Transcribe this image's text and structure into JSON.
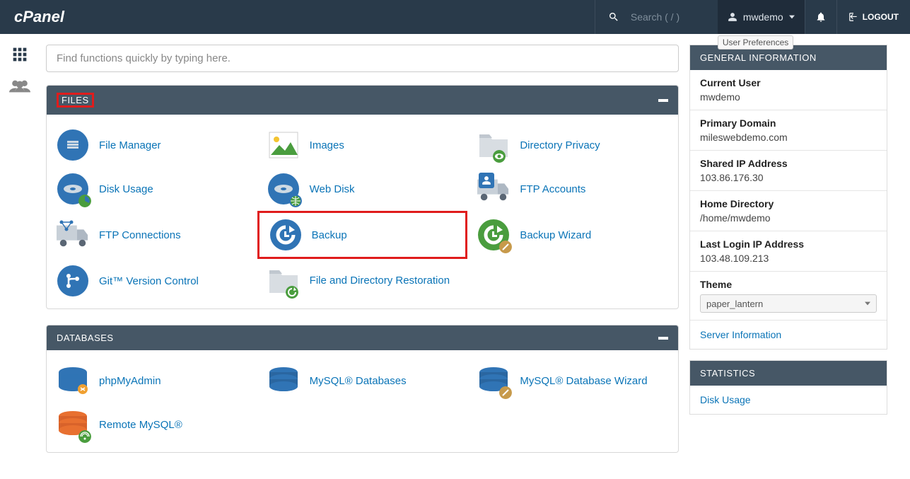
{
  "header": {
    "search_placeholder": "Search ( / )",
    "username": "mwdemo",
    "logout": "LOGOUT",
    "tooltip": "User Preferences"
  },
  "find_placeholder": "Find functions quickly by typing here.",
  "panels": {
    "files": {
      "title": "FILES",
      "items": [
        {
          "label": "File Manager"
        },
        {
          "label": "Images"
        },
        {
          "label": "Directory Privacy"
        },
        {
          "label": "Disk Usage"
        },
        {
          "label": "Web Disk"
        },
        {
          "label": "FTP Accounts"
        },
        {
          "label": "FTP Connections"
        },
        {
          "label": "Backup"
        },
        {
          "label": "Backup Wizard"
        },
        {
          "label": "Git™ Version Control"
        },
        {
          "label": "File and Directory Restoration"
        }
      ]
    },
    "databases": {
      "title": "DATABASES",
      "items": [
        {
          "label": "phpMyAdmin"
        },
        {
          "label": "MySQL® Databases"
        },
        {
          "label": "MySQL® Database Wizard"
        },
        {
          "label": "Remote MySQL®"
        }
      ]
    }
  },
  "general": {
    "title": "GENERAL INFORMATION",
    "current_user_label": "Current User",
    "current_user": "mwdemo",
    "primary_domain_label": "Primary Domain",
    "primary_domain": "mileswebdemo.com",
    "shared_ip_label": "Shared IP Address",
    "shared_ip": "103.86.176.30",
    "home_dir_label": "Home Directory",
    "home_dir": "/home/mwdemo",
    "last_login_label": "Last Login IP Address",
    "last_login": "103.48.109.213",
    "theme_label": "Theme",
    "theme_value": "paper_lantern",
    "server_info": "Server Information"
  },
  "stats": {
    "title": "STATISTICS",
    "disk_usage": "Disk Usage"
  },
  "highlights": {
    "files_title": true,
    "backup_item": true
  },
  "colors": {
    "primary_blue": "#3074b5",
    "header_bg": "#293a4a",
    "panel_bg": "#465766",
    "link": "#0a74b7",
    "highlight": "#e01c1c"
  }
}
